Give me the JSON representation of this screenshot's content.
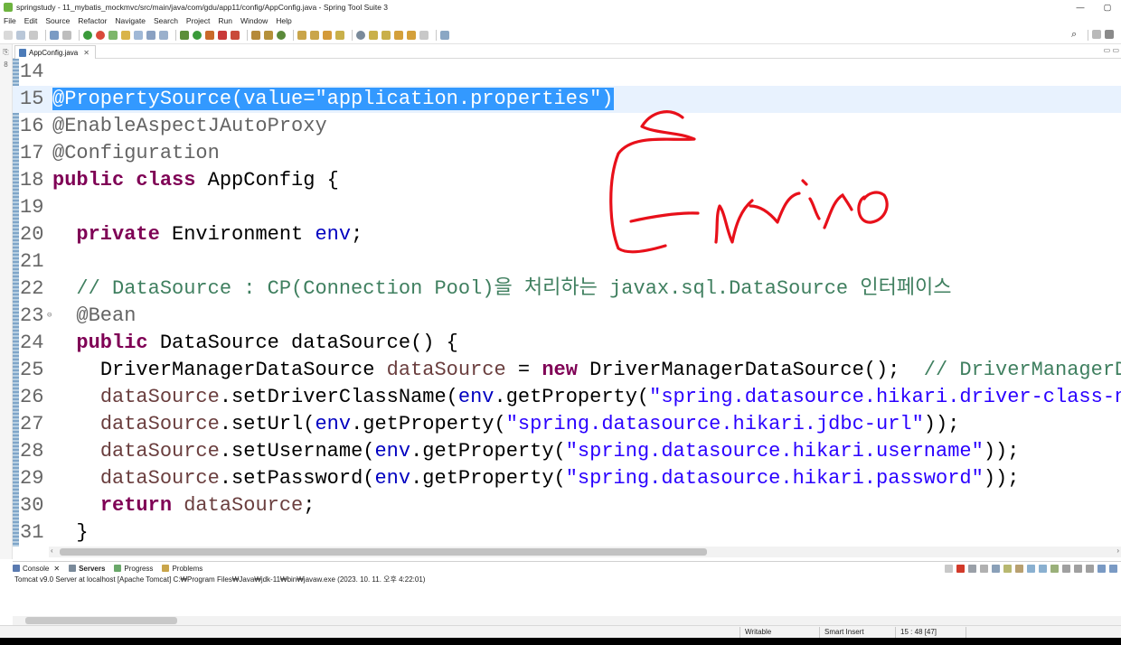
{
  "window": {
    "title": "springstudy - 11_mybatis_mockmvc/src/main/java/com/gdu/app11/config/AppConfig.java - Spring Tool Suite 3",
    "minimize": "—",
    "maximize": "▢",
    "close": "✕"
  },
  "menu": [
    "File",
    "Edit",
    "Source",
    "Refactor",
    "Navigate",
    "Search",
    "Project",
    "Run",
    "Window",
    "Help"
  ],
  "left_strip": {
    "icon1": "⎘",
    "icon2": "8"
  },
  "editor_tab": {
    "label": "AppConfig.java",
    "close": "✕"
  },
  "tab_controls": "▭ ▭",
  "code": {
    "l14": {
      "n": "14"
    },
    "l15": {
      "n": "15",
      "text": "@PropertySource(value=\"application.properties\")"
    },
    "l16": {
      "n": "16",
      "text": "@EnableAspectJAutoProxy"
    },
    "l17": {
      "n": "17",
      "text": "@Configuration"
    },
    "l18": {
      "n": "18",
      "kw": "public class",
      "rest": " AppConfig {"
    },
    "l19": {
      "n": "19"
    },
    "l20": {
      "n": "20",
      "indent": "  ",
      "kw": "private",
      "type": " Environment ",
      "fld": "env",
      "end": ";"
    },
    "l21": {
      "n": "21"
    },
    "l22": {
      "n": "22",
      "indent": "  ",
      "cmt": "// DataSource : CP(Connection Pool)을 처리하는 javax.sql.DataSource 인터페이스"
    },
    "l23": {
      "n": "23",
      "fold": "⊖",
      "indent": "  ",
      "ann": "@Bean"
    },
    "l24": {
      "n": "24",
      "indent": "  ",
      "kw": "public",
      "rest": " DataSource dataSource() {"
    },
    "l25": {
      "n": "25",
      "indent": "    ",
      "type": "DriverManagerDataSource ",
      "loc": "dataSource",
      "mid": " = ",
      "kw": "new",
      "rest": " DriverManagerDataSource();  ",
      "cmt": "// DriverManagerD"
    },
    "l26": {
      "n": "26",
      "indent": "    ",
      "loc": "dataSource",
      "call": ".setDriverClassName(",
      "fld": "env",
      "get": ".getProperty(",
      "str": "\"spring.datasource.hikari.driver-class-n"
    },
    "l27": {
      "n": "27",
      "indent": "    ",
      "loc": "dataSource",
      "call": ".setUrl(",
      "fld": "env",
      "get": ".getProperty(",
      "str": "\"spring.datasource.hikari.jdbc-url\"",
      "end": "));"
    },
    "l28": {
      "n": "28",
      "indent": "    ",
      "loc": "dataSource",
      "call": ".setUsername(",
      "fld": "env",
      "get": ".getProperty(",
      "str": "\"spring.datasource.hikari.username\"",
      "end": "));"
    },
    "l29": {
      "n": "29",
      "indent": "    ",
      "loc": "dataSource",
      "call": ".setPassword(",
      "fld": "env",
      "get": ".getProperty(",
      "str": "\"spring.datasource.hikari.password\"",
      "end": "));"
    },
    "l30": {
      "n": "30",
      "indent": "    ",
      "kw": "return",
      "sp": " ",
      "loc": "dataSource",
      "end": ";"
    },
    "l31": {
      "n": "31",
      "indent": "  ",
      "rest": "}"
    }
  },
  "handwriting_text": "Enviro",
  "console_tabs": {
    "console": "Console",
    "servers": "Servers",
    "progress": "Progress",
    "problems": "Problems"
  },
  "console_description": "Tomcat v9.0 Server at localhost [Apache Tomcat] C:₩Program Files₩Java₩jdk-11₩bin₩javaw.exe  (2023. 10. 11. 오후 4:22:01)",
  "status": {
    "writable": "Writable",
    "insert_mode": "Smart Insert",
    "position": "15 : 48 [47]"
  },
  "colors": {
    "keyword": "#7f0055",
    "string": "#2a00ff",
    "comment": "#3f7f5f",
    "field": "#0000c0",
    "local_var": "#6a3e3e",
    "annotation": "#646464",
    "selection": "#3399ff",
    "current_line": "#e8f2fe"
  },
  "icons": [
    "window-app-icon",
    "search-icon",
    "run-icon",
    "debug-icon",
    "save-icon",
    "new-icon"
  ]
}
